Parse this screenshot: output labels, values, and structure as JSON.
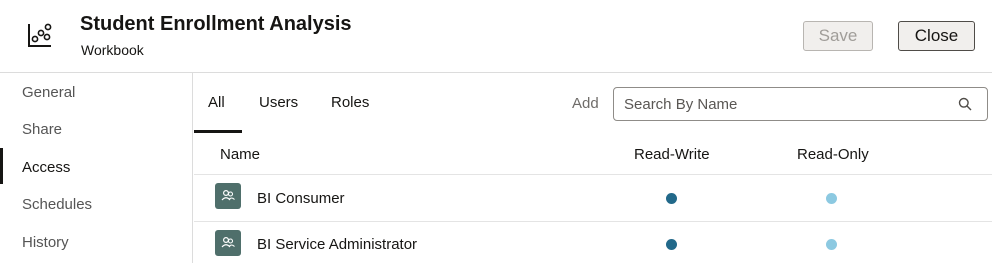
{
  "header": {
    "title": "Student Enrollment Analysis",
    "subtitle": "Workbook",
    "icon": "scatter-chart-icon",
    "save_label": "Save",
    "close_label": "Close"
  },
  "sidebar": {
    "items": [
      {
        "label": "General"
      },
      {
        "label": "Share"
      },
      {
        "label": "Access"
      },
      {
        "label": "Schedules"
      },
      {
        "label": "History"
      }
    ],
    "active": "Access"
  },
  "tabs": {
    "items": [
      {
        "label": "All"
      },
      {
        "label": "Users"
      },
      {
        "label": "Roles"
      }
    ],
    "active": "All"
  },
  "search": {
    "add_label": "Add",
    "placeholder": "Search By Name",
    "icon": "search-icon"
  },
  "table": {
    "columns": [
      "Name",
      "Read-Write",
      "Read-Only"
    ],
    "rows": [
      {
        "name": "BI Consumer",
        "icon": "role-icon",
        "read_write": true,
        "read_only": true
      },
      {
        "name": "BI Service Administrator",
        "icon": "role-icon",
        "read_write": true,
        "read_only": true
      }
    ]
  },
  "colors": {
    "read_write_dot": "#22698a",
    "read_only_dot": "#8cc9e1",
    "role_icon_bg": "#4f6f6b"
  }
}
